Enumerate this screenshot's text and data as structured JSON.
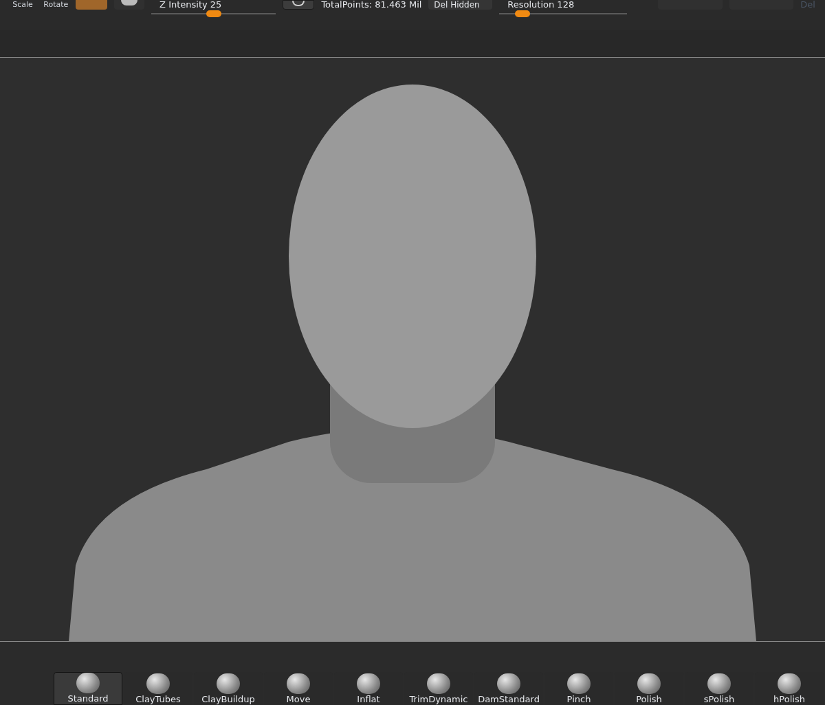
{
  "top_bar": {
    "labels": [
      "Scale",
      "Rotate"
    ],
    "z_intensity": {
      "label": "Z Intensity 25",
      "level": 0.5
    },
    "total_points": "TotalPoints: 81.463 Mil",
    "del_hidden": "Del Hidden",
    "resolution": {
      "label": "Resolution 128",
      "level": 0.18
    },
    "faded_label": "Del"
  },
  "brushes": [
    {
      "name": "Standard",
      "selected": true
    },
    {
      "name": "ClayTubes",
      "selected": false
    },
    {
      "name": "ClayBuildup",
      "selected": false
    },
    {
      "name": "Move",
      "selected": false
    },
    {
      "name": "Inflat",
      "selected": false
    },
    {
      "name": "TrimDynamic",
      "selected": false
    },
    {
      "name": "DamStandard",
      "selected": false
    },
    {
      "name": "Pinch",
      "selected": false
    },
    {
      "name": "Polish",
      "selected": false
    },
    {
      "name": "sPolish",
      "selected": false
    },
    {
      "name": "hPolish",
      "selected": false
    }
  ]
}
